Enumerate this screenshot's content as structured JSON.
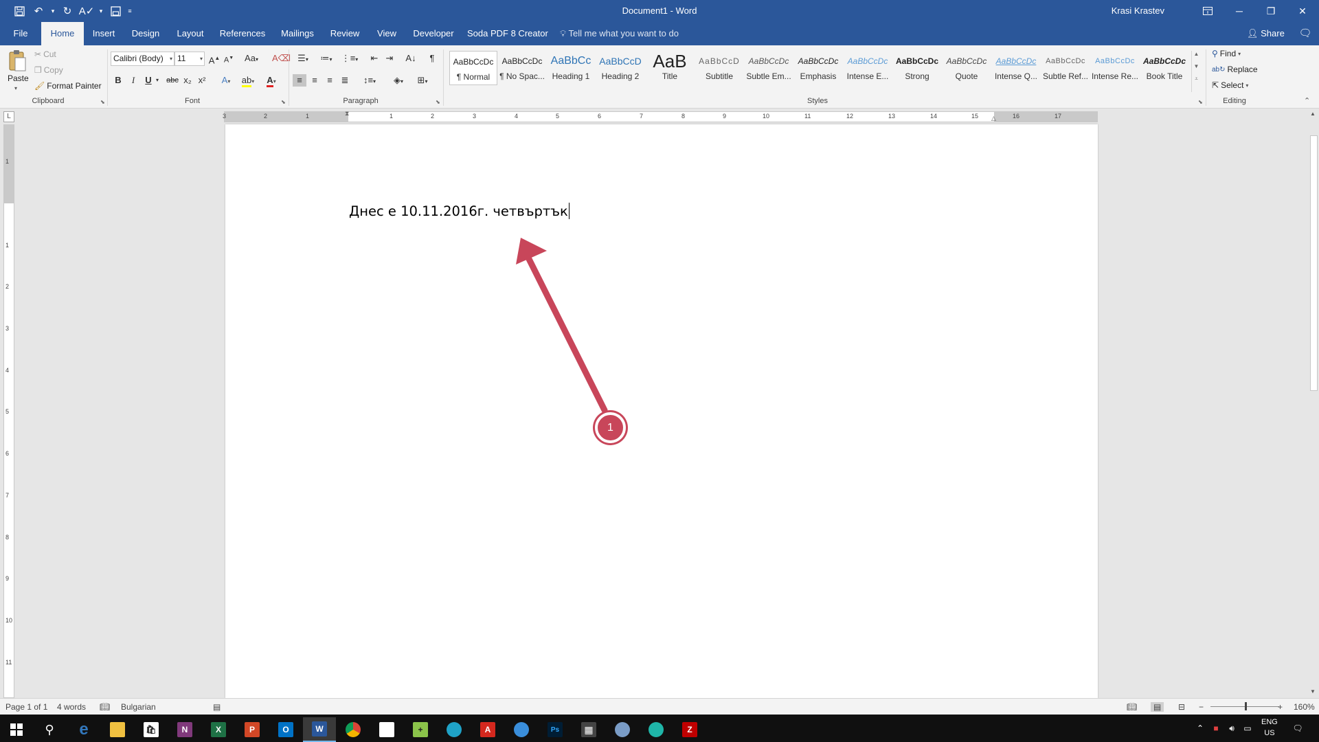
{
  "window": {
    "title": "Document1 - Word",
    "user": "Krasi Krastev"
  },
  "qat": {
    "save_icon": "save-icon",
    "undo_icon": "undo-icon",
    "redo_icon": "redo-icon",
    "spelling_icon": "spelling-icon",
    "customize_icon": "customize-qat-icon"
  },
  "tabs": [
    {
      "label": "File"
    },
    {
      "label": "Home"
    },
    {
      "label": "Insert"
    },
    {
      "label": "Design"
    },
    {
      "label": "Layout"
    },
    {
      "label": "References"
    },
    {
      "label": "Mailings"
    },
    {
      "label": "Review"
    },
    {
      "label": "View"
    },
    {
      "label": "Developer"
    },
    {
      "label": "Soda PDF 8 Creator"
    }
  ],
  "tellme": "Tell me what you want to do",
  "share": "Share",
  "clipboard": {
    "paste": "Paste",
    "cut": "Cut",
    "copy": "Copy",
    "format_painter": "Format Painter",
    "group": "Clipboard"
  },
  "font": {
    "name": "Calibri (Body)",
    "size": "11",
    "case": "Aa",
    "bold": "B",
    "italic": "I",
    "underline": "U",
    "strike": "abc",
    "subscript": "x₂",
    "superscript": "x²",
    "group": "Font"
  },
  "paragraph": {
    "group": "Paragraph"
  },
  "styles": {
    "group": "Styles",
    "items": [
      {
        "preview": "AaBbCcDc",
        "label": "¶ Normal"
      },
      {
        "preview": "AaBbCcDc",
        "label": "¶ No Spac..."
      },
      {
        "preview": "AaBbCc",
        "label": "Heading 1"
      },
      {
        "preview": "AaBbCcD",
        "label": "Heading 2"
      },
      {
        "preview": "AaB",
        "label": "Title"
      },
      {
        "preview": "AaBbCcD",
        "label": "Subtitle"
      },
      {
        "preview": "AaBbCcDc",
        "label": "Subtle Em..."
      },
      {
        "preview": "AaBbCcDc",
        "label": "Emphasis"
      },
      {
        "preview": "AaBbCcDc",
        "label": "Intense E..."
      },
      {
        "preview": "AaBbCcDc",
        "label": "Strong"
      },
      {
        "preview": "AaBbCcDc",
        "label": "Quote"
      },
      {
        "preview": "AaBbCcDc",
        "label": "Intense Q..."
      },
      {
        "preview": "AaBbCcDc",
        "label": "Subtle Ref..."
      },
      {
        "preview": "AaBbCcDc",
        "label": "Intense Re..."
      },
      {
        "preview": "AaBbCcDc",
        "label": "Book Title"
      }
    ]
  },
  "editing": {
    "find": "Find",
    "replace": "Replace",
    "select": "Select",
    "group": "Editing"
  },
  "ruler": {
    "h_numbers": [
      "3",
      "2",
      "1",
      "1",
      "2",
      "3",
      "4",
      "5",
      "6",
      "7",
      "8",
      "9",
      "10",
      "11",
      "12",
      "13",
      "14",
      "15",
      "16",
      "17"
    ],
    "v_numbers": [
      "1",
      "1",
      "2",
      "3",
      "4",
      "5",
      "6",
      "7",
      "8",
      "9",
      "10",
      "11"
    ],
    "corner": "L"
  },
  "document": {
    "text": "Днес е 10.11.2016г. четвъртък"
  },
  "annotation": {
    "badge": "1",
    "color": "#c8465a"
  },
  "status": {
    "page": "Page 1 of 1",
    "words": "4 words",
    "language": "Bulgarian",
    "zoom": "160%",
    "zoom_minus": "−",
    "zoom_plus": "+"
  },
  "taskbar": {
    "apps": [
      "start-icon",
      "search-icon",
      "edge-icon",
      "file-explorer-icon",
      "store-icon",
      "onenote-icon",
      "excel-icon",
      "powerpoint-icon",
      "outlook-icon",
      "word-icon",
      "chrome-icon",
      "notepad-icon",
      "notepad-plus-icon",
      "sourcetree-icon",
      "acrobat-icon",
      "messenger-icon",
      "photoshop-icon",
      "calculator-icon",
      "paint-icon",
      "sourcetree2-icon",
      "filezilla-icon"
    ],
    "tray_lang_top": "ENG",
    "tray_lang_bottom": "US"
  },
  "colors": {
    "accent": "#2b579a",
    "ribbon_bg": "#f3f3f3",
    "page_bg": "#ffffff",
    "workspace_bg": "#e6e6e6"
  }
}
